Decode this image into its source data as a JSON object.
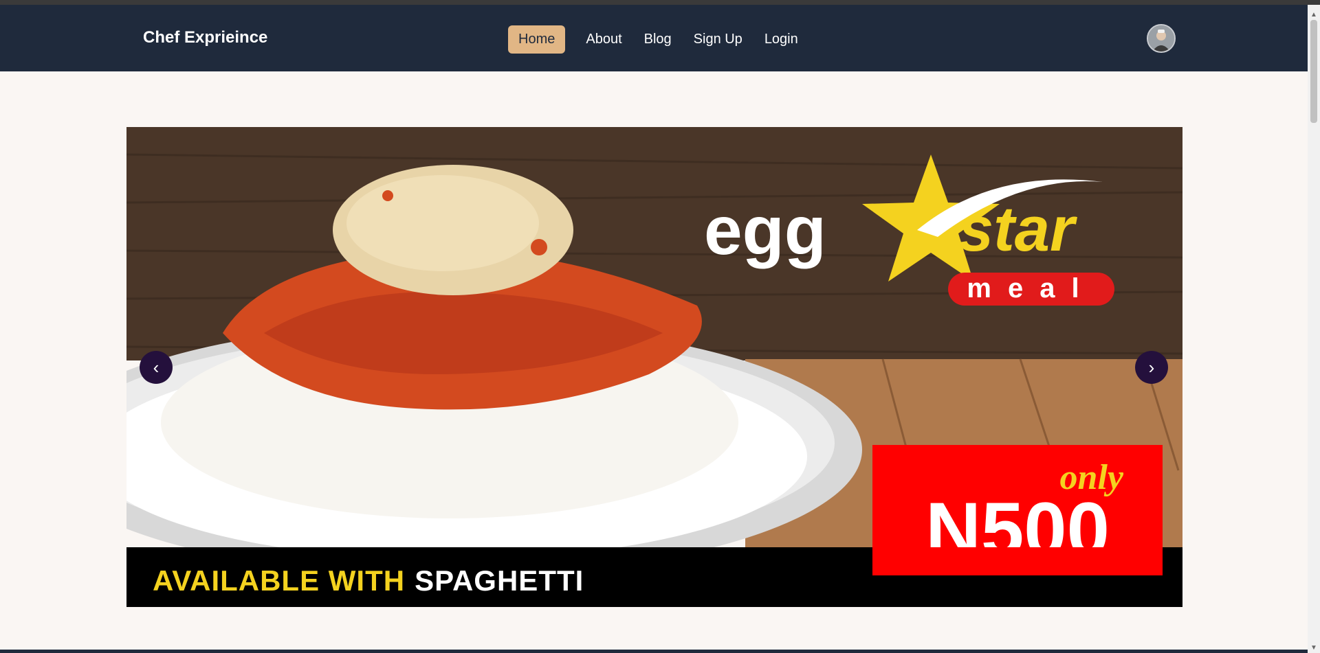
{
  "brand": "Chef Exprieince",
  "nav": {
    "items": [
      {
        "label": "Home",
        "active": true
      },
      {
        "label": "About",
        "active": false
      },
      {
        "label": "Blog",
        "active": false
      },
      {
        "label": "Sign Up",
        "active": false
      },
      {
        "label": "Login",
        "active": false
      }
    ]
  },
  "avatar_icon": "user-avatar-icon",
  "carousel": {
    "slide": {
      "headline_left": "egg",
      "headline_right": "star",
      "sub_badge": "meal",
      "price_prefix": "only",
      "price": "N500",
      "footer_yellow": "AVAILABLE WITH",
      "footer_white": "SPAGHETTI"
    },
    "prev_label": "‹",
    "next_label": "›"
  },
  "colors": {
    "navbar": "#1f2a3c",
    "active_nav": "#e1b685",
    "page_bg": "#faf6f3",
    "carousel_control": "#24103c",
    "price_badge": "#ff0000",
    "star_yellow": "#f4d21f"
  }
}
